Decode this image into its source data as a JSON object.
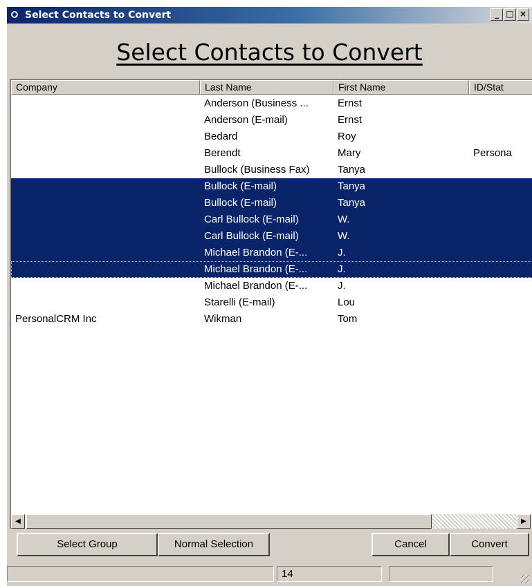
{
  "window": {
    "title": "Select Contacts to Convert",
    "controls": {
      "minimize": "_",
      "maximize": "□",
      "close": "×"
    }
  },
  "heading": "Select Contacts to Convert",
  "list": {
    "columns": [
      "Company",
      "Last Name",
      "First Name",
      "ID/Stat"
    ],
    "rows": [
      {
        "company": "",
        "last": "Anderson (Business ...",
        "first": "Ernst",
        "id": "",
        "selected": false
      },
      {
        "company": "",
        "last": "Anderson (E-mail)",
        "first": "Ernst",
        "id": "",
        "selected": false
      },
      {
        "company": "",
        "last": "Bedard",
        "first": "Roy",
        "id": "",
        "selected": false
      },
      {
        "company": "",
        "last": "Berendt",
        "first": "Mary",
        "id": "Persona",
        "selected": false
      },
      {
        "company": "",
        "last": "Bullock (Business Fax)",
        "first": "Tanya",
        "id": "",
        "selected": false
      },
      {
        "company": "",
        "last": "Bullock (E-mail)",
        "first": "Tanya",
        "id": "",
        "selected": true
      },
      {
        "company": "",
        "last": "Bullock (E-mail)",
        "first": "Tanya",
        "id": "",
        "selected": true
      },
      {
        "company": "",
        "last": "Carl Bullock (E-mail)",
        "first": "W.",
        "id": "",
        "selected": true
      },
      {
        "company": "",
        "last": "Carl Bullock (E-mail)",
        "first": "W.",
        "id": "",
        "selected": true
      },
      {
        "company": "",
        "last": "Michael Brandon (E-...",
        "first": "J.",
        "id": "",
        "selected": true
      },
      {
        "company": "",
        "last": "Michael Brandon (E-...",
        "first": "J.",
        "id": "",
        "selected": true,
        "focused": true
      },
      {
        "company": "",
        "last": "Michael Brandon (E-...",
        "first": "J.",
        "id": "",
        "selected": false
      },
      {
        "company": "",
        "last": "Starelli (E-mail)",
        "first": "Lou",
        "id": "",
        "selected": false
      },
      {
        "company": "PersonalCRM Inc",
        "last": "Wikman",
        "first": "Tom",
        "id": "",
        "selected": false
      }
    ],
    "scroll_left_icon": "◀",
    "scroll_right_icon": "▶"
  },
  "buttons": {
    "select_group": "Select Group",
    "normal_selection": "Normal Selection",
    "cancel": "Cancel",
    "convert": "Convert"
  },
  "status": {
    "count": "14"
  },
  "colors": {
    "selection": "#0a246a",
    "face": "#d4d0c8",
    "title_start": "#0a246a"
  }
}
